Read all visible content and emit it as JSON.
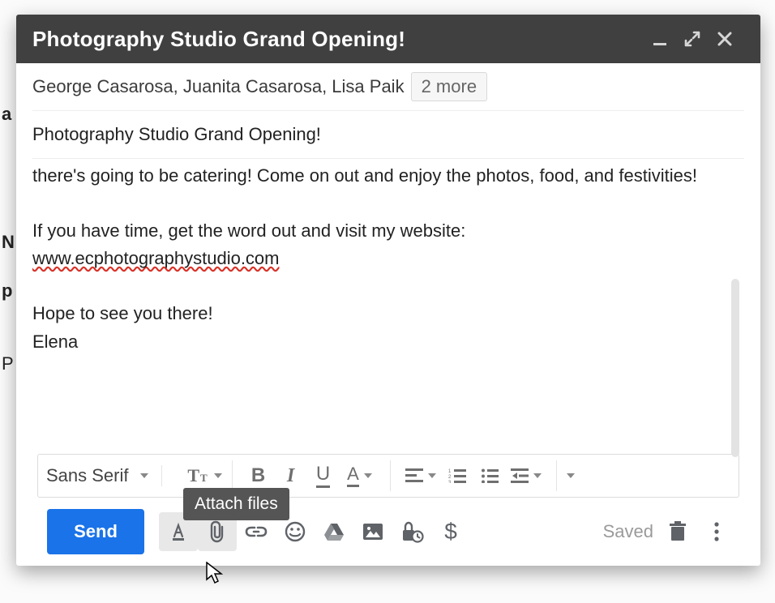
{
  "header": {
    "title": "Photography Studio Grand Opening!"
  },
  "recipients": {
    "names": "George Casarosa, Juanita Casarosa, Lisa Paik",
    "more": "2 more"
  },
  "subject": "Photography Studio Grand Opening!",
  "body": {
    "p1": "there's going to be catering! Come on out and enjoy the photos, food, and festivities!",
    "p2": "If you have time, get the word out and visit my website:",
    "url": "www.ecphotographystudio.com",
    "p3": "Hope to see you there!",
    "signoff": "Elena"
  },
  "formatting": {
    "font_family": "Sans Serif"
  },
  "tooltip": "Attach files",
  "bottom": {
    "send": "Send",
    "saved": "Saved"
  },
  "bg_letters": {
    "a": "a",
    "n": "N",
    "p": "p",
    "p2": "P"
  }
}
